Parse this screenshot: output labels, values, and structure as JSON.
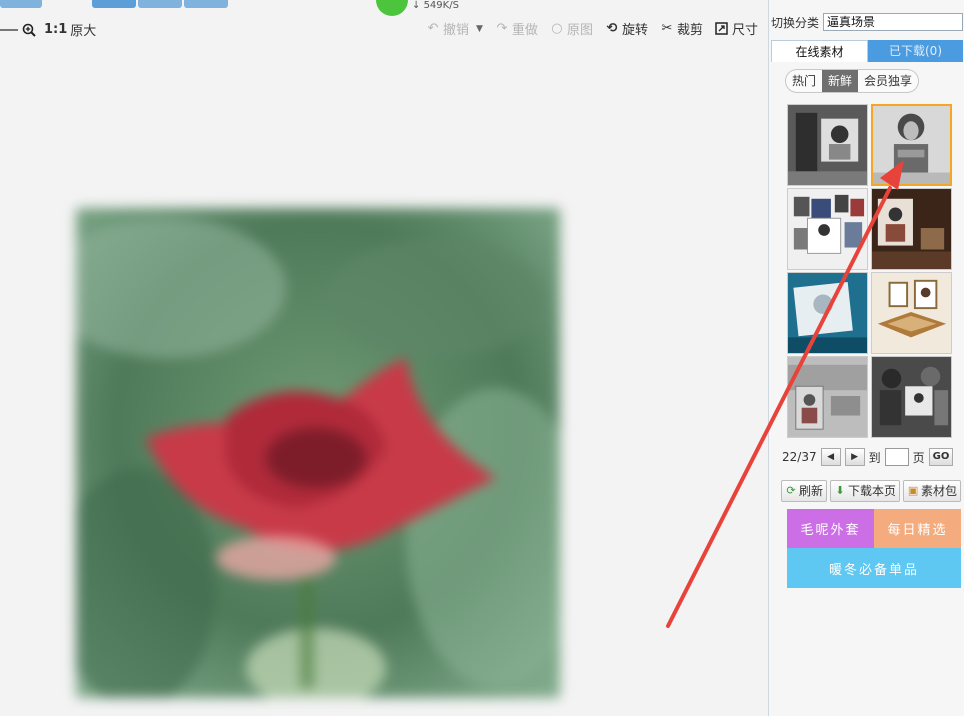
{
  "download": {
    "speed": "549K/S"
  },
  "toolbar": {
    "zoom_label": "1:1",
    "original_size": "原大",
    "undo": "撤销",
    "redo": "重做",
    "original": "原图",
    "rotate": "旋转",
    "crop": "裁剪",
    "size": "尺寸"
  },
  "panel": {
    "category_label": "切换分类",
    "category_value": "逼真场景",
    "tabs": [
      "在线素材",
      "已下载(0)"
    ],
    "subtabs": [
      "热门",
      "新鲜",
      "会员独享"
    ],
    "active_subtab": 1,
    "selected_thumb": 1,
    "pager": {
      "current": "22/37",
      "goto_label": "到",
      "page_unit": "页",
      "go": "GO"
    },
    "actions": [
      "刷新",
      "下载本页",
      "素材包"
    ],
    "banners": [
      "毛呢外套",
      "每日精选",
      "暖冬必备单品"
    ]
  },
  "colors": {
    "accent_blue": "#4a9be0",
    "selection_orange": "#f5a623",
    "arrow_red": "#e8433a",
    "banner_purple": "#cc6fe6",
    "banner_orange": "#f4ab7d",
    "banner_blue": "#5ec7f2"
  }
}
